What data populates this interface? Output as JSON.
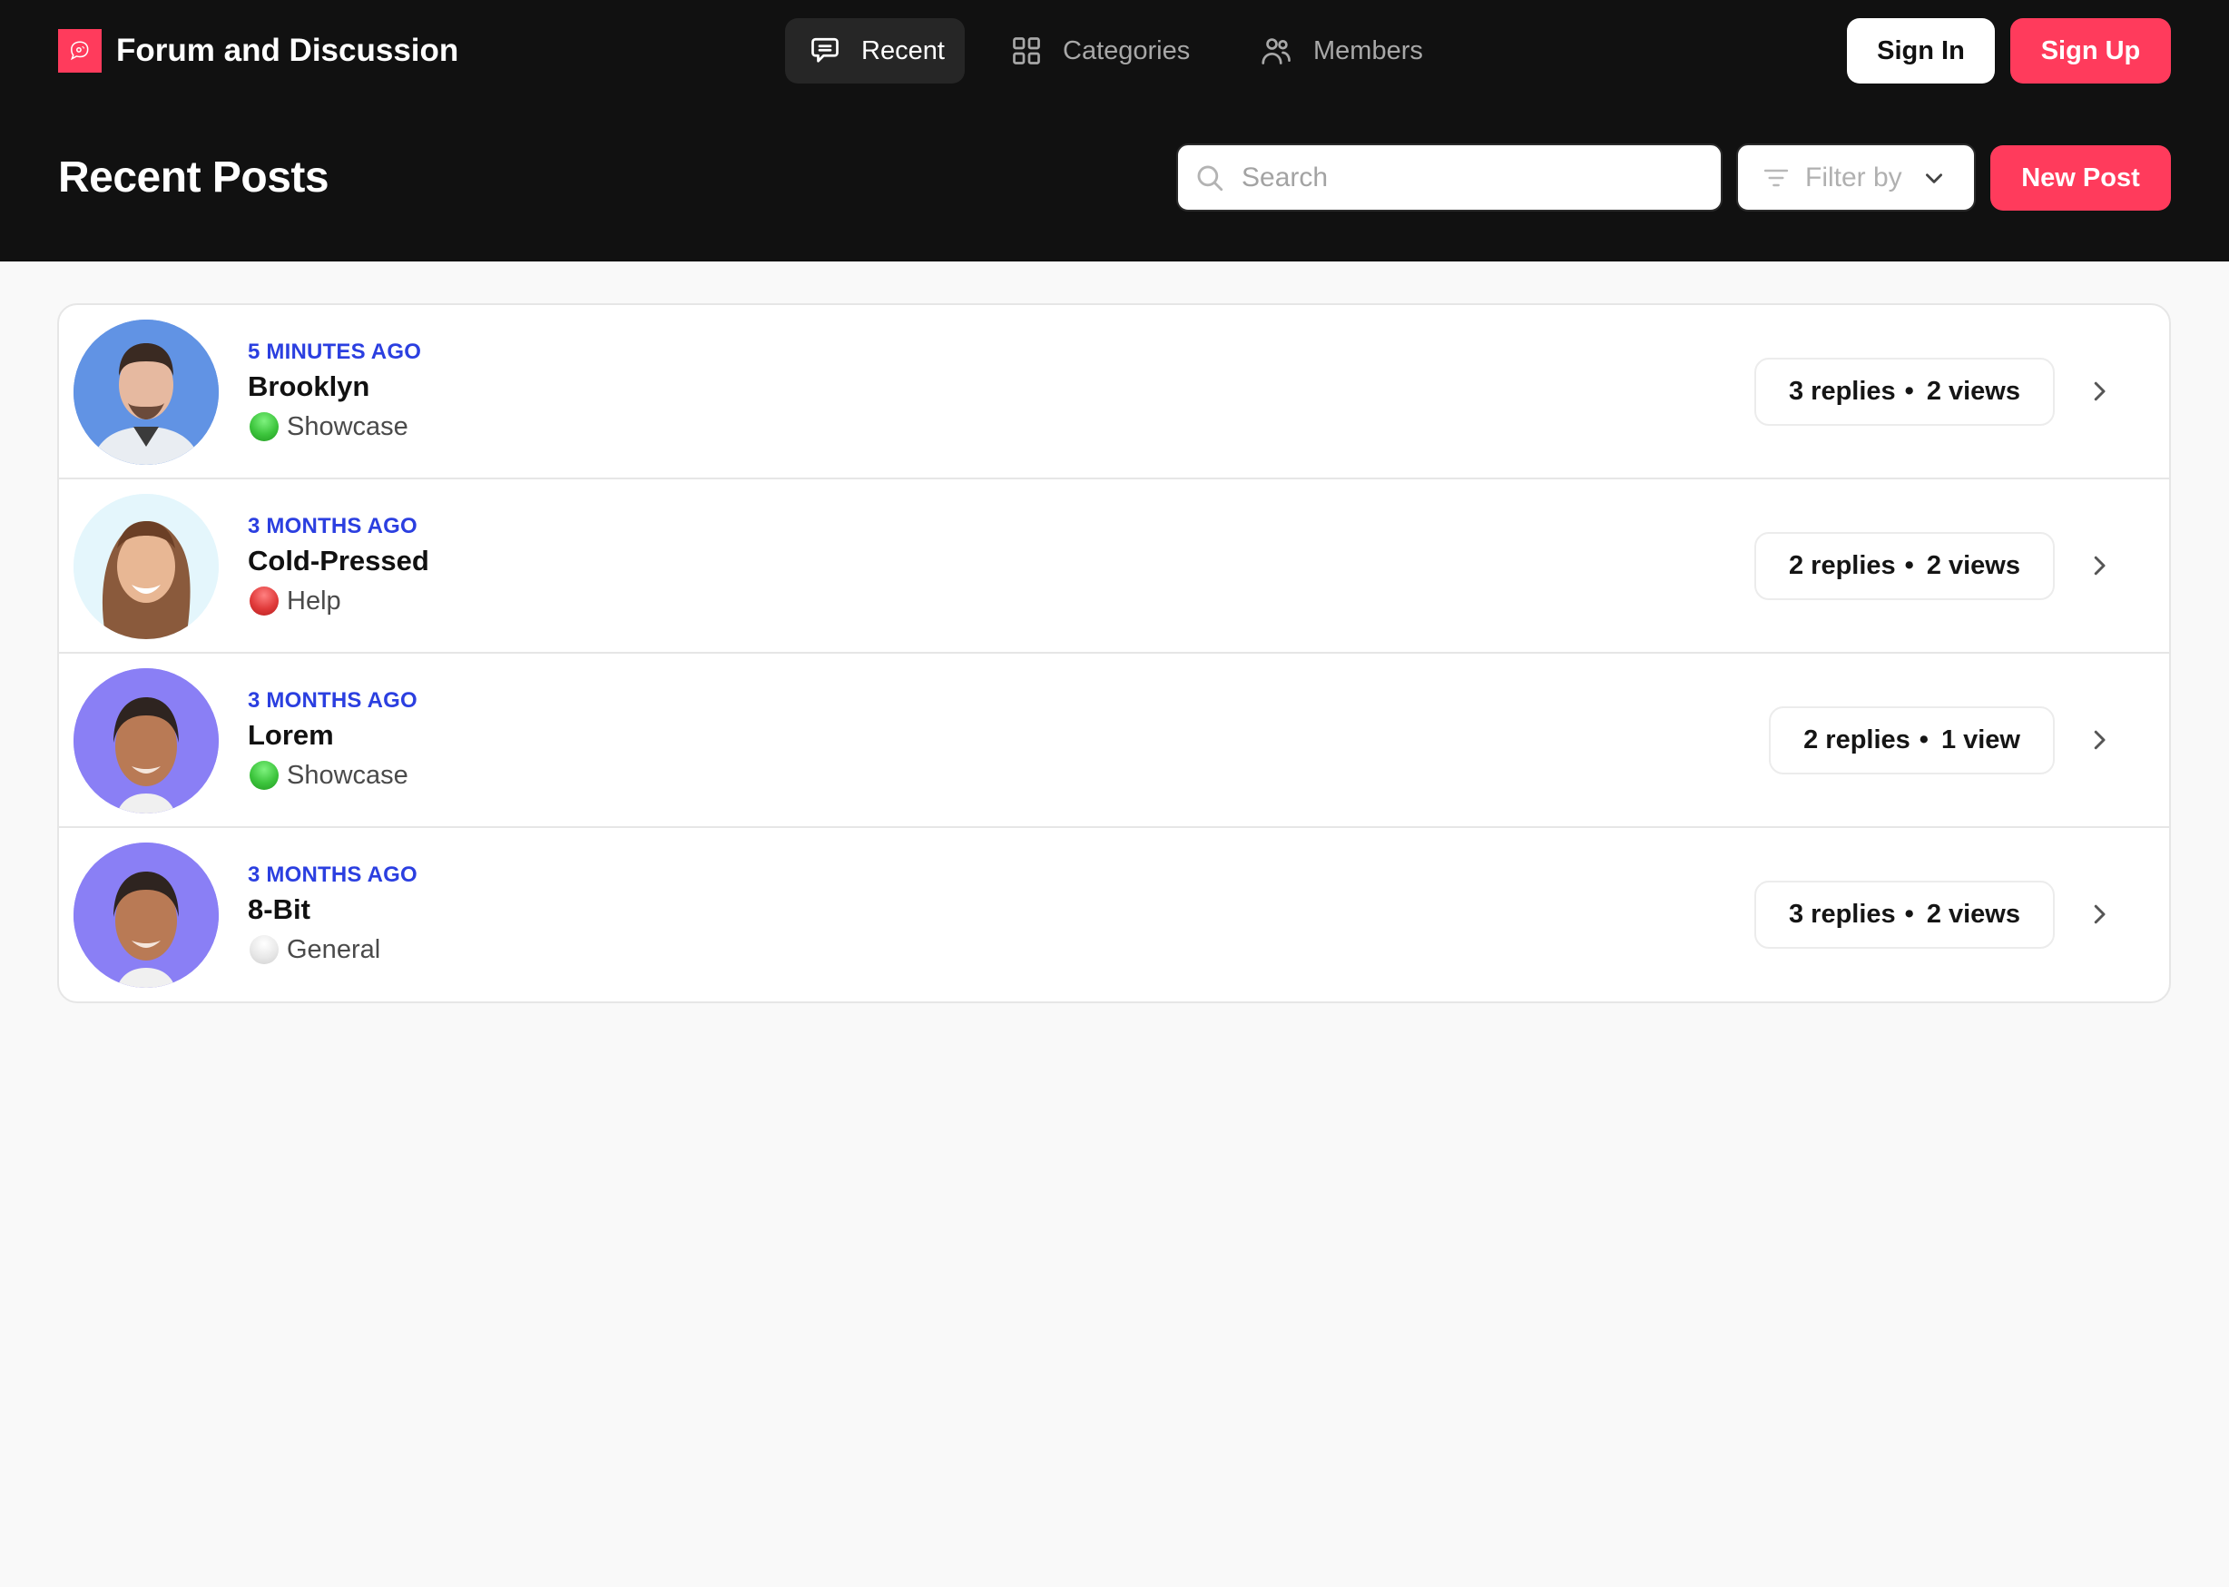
{
  "app": {
    "title": "Forum and Discussion",
    "brand_color": "#ff3b5c",
    "logo_icon": "chat-bubble-icon"
  },
  "nav": {
    "tabs": [
      {
        "label": "Recent",
        "icon": "chat-bubble-icon",
        "active": true
      },
      {
        "label": "Categories",
        "icon": "grid-icon",
        "active": false
      },
      {
        "label": "Members",
        "icon": "users-icon",
        "active": false
      }
    ]
  },
  "auth": {
    "sign_in_label": "Sign In",
    "sign_up_label": "Sign Up"
  },
  "toolbar": {
    "page_title": "Recent Posts",
    "search_placeholder": "Search",
    "search_value": "",
    "filter_label": "Filter by",
    "new_post_label": "New Post"
  },
  "posts": [
    {
      "time": "5 MINUTES AGO",
      "title": "Brooklyn",
      "category": "Showcase",
      "category_color": "#3cc43c",
      "replies": "3 replies",
      "views": "2 views",
      "avatar_bg": "#5b8fe0"
    },
    {
      "time": "3 MONTHS AGO",
      "title": "Cold-Pressed",
      "category": "Help",
      "category_color": "#e03a3a",
      "replies": "2 replies",
      "views": "2 views",
      "avatar_bg": "#e4f6fc"
    },
    {
      "time": "3 MONTHS AGO",
      "title": "Lorem",
      "category": "Showcase",
      "category_color": "#3cc43c",
      "replies": "2 replies",
      "views": "1 view",
      "avatar_bg": "#8a7ff5"
    },
    {
      "time": "3 MONTHS AGO",
      "title": "8-Bit",
      "category": "General",
      "category_color": "#e4e4e4",
      "replies": "3 replies",
      "views": "2 views",
      "avatar_bg": "#8a7ff5"
    }
  ],
  "stats_separator": "•"
}
